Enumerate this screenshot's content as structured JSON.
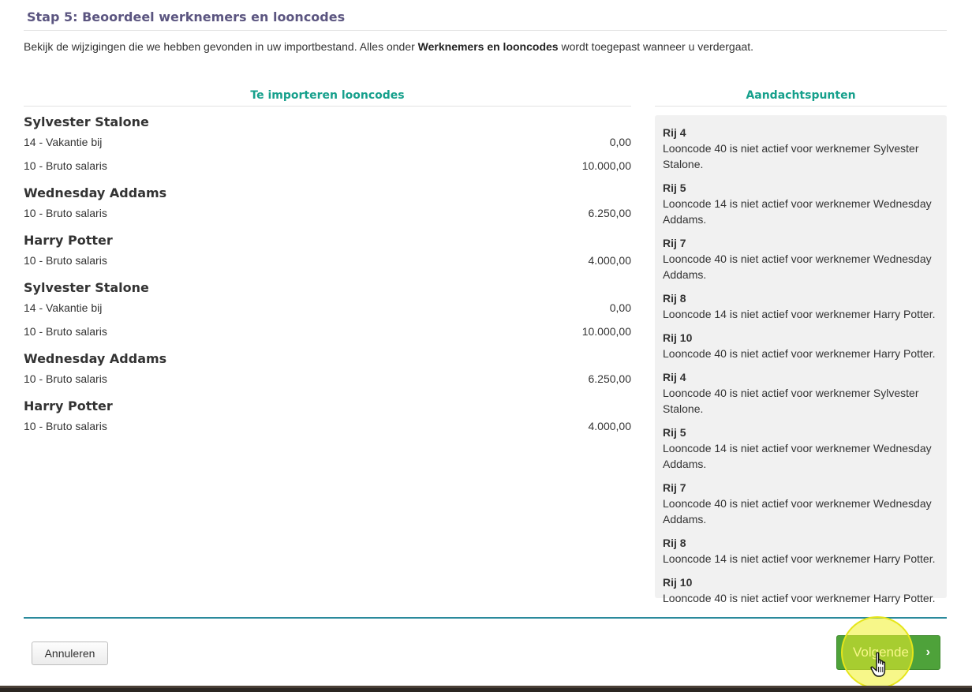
{
  "step": {
    "title": "Stap 5: Beoordeel werknemers en looncodes"
  },
  "intro": {
    "before": "Bekijk de wijzigingen die we hebben gevonden in uw importbestand. Alles onder ",
    "bold": "Werknemers en looncodes",
    "after": " wordt toegepast wanneer u verdergaat."
  },
  "import": {
    "heading": "Te importeren looncodes",
    "employees": [
      {
        "name": "Sylvester Stalone",
        "codes": [
          {
            "label": "14 - Vakantie bij",
            "amount": "0,00"
          },
          {
            "label": "10 - Bruto salaris",
            "amount": "10.000,00"
          }
        ]
      },
      {
        "name": "Wednesday Addams",
        "codes": [
          {
            "label": "10 - Bruto salaris",
            "amount": "6.250,00"
          }
        ]
      },
      {
        "name": "Harry Potter",
        "codes": [
          {
            "label": "10 - Bruto salaris",
            "amount": "4.000,00"
          }
        ]
      },
      {
        "name": "Sylvester Stalone",
        "codes": [
          {
            "label": "14 - Vakantie bij",
            "amount": "0,00"
          },
          {
            "label": "10 - Bruto salaris",
            "amount": "10.000,00"
          }
        ]
      },
      {
        "name": "Wednesday Addams",
        "codes": [
          {
            "label": "10 - Bruto salaris",
            "amount": "6.250,00"
          }
        ]
      },
      {
        "name": "Harry Potter",
        "codes": [
          {
            "label": "10 - Bruto salaris",
            "amount": "4.000,00"
          }
        ]
      }
    ]
  },
  "attention": {
    "heading": "Aandachtspunten",
    "notes": [
      {
        "row": "Rij 4",
        "message": "Looncode 40 is niet actief voor werknemer Sylvester Stalone."
      },
      {
        "row": "Rij 5",
        "message": "Looncode 14 is niet actief voor werknemer Wednesday Addams."
      },
      {
        "row": "Rij 7",
        "message": "Looncode 40 is niet actief voor werknemer Wednesday Addams."
      },
      {
        "row": "Rij 8",
        "message": "Looncode 14 is niet actief voor werknemer Harry Potter."
      },
      {
        "row": "Rij 10",
        "message": "Looncode 40 is niet actief voor werknemer Harry Potter."
      },
      {
        "row": "Rij 4",
        "message": "Looncode 40 is niet actief voor werknemer Sylvester Stalone."
      },
      {
        "row": "Rij 5",
        "message": "Looncode 14 is niet actief voor werknemer Wednesday Addams."
      },
      {
        "row": "Rij 7",
        "message": "Looncode 40 is niet actief voor werknemer Wednesday Addams."
      },
      {
        "row": "Rij 8",
        "message": "Looncode 14 is niet actief voor werknemer Harry Potter."
      },
      {
        "row": "Rij 10",
        "message": "Looncode 40 is niet actief voor werknemer Harry Potter."
      }
    ]
  },
  "footer": {
    "cancel_label": "Annuleren",
    "next_label": "Volgende",
    "next_icon": "chevron-right-icon"
  },
  "colors": {
    "title": "#5b5580",
    "section_heading": "#16a08c",
    "divider": "#2a8a9c",
    "next_button": "#4ea23a",
    "notes_background": "#f1f1f1",
    "click_highlight": "#f0f028"
  }
}
